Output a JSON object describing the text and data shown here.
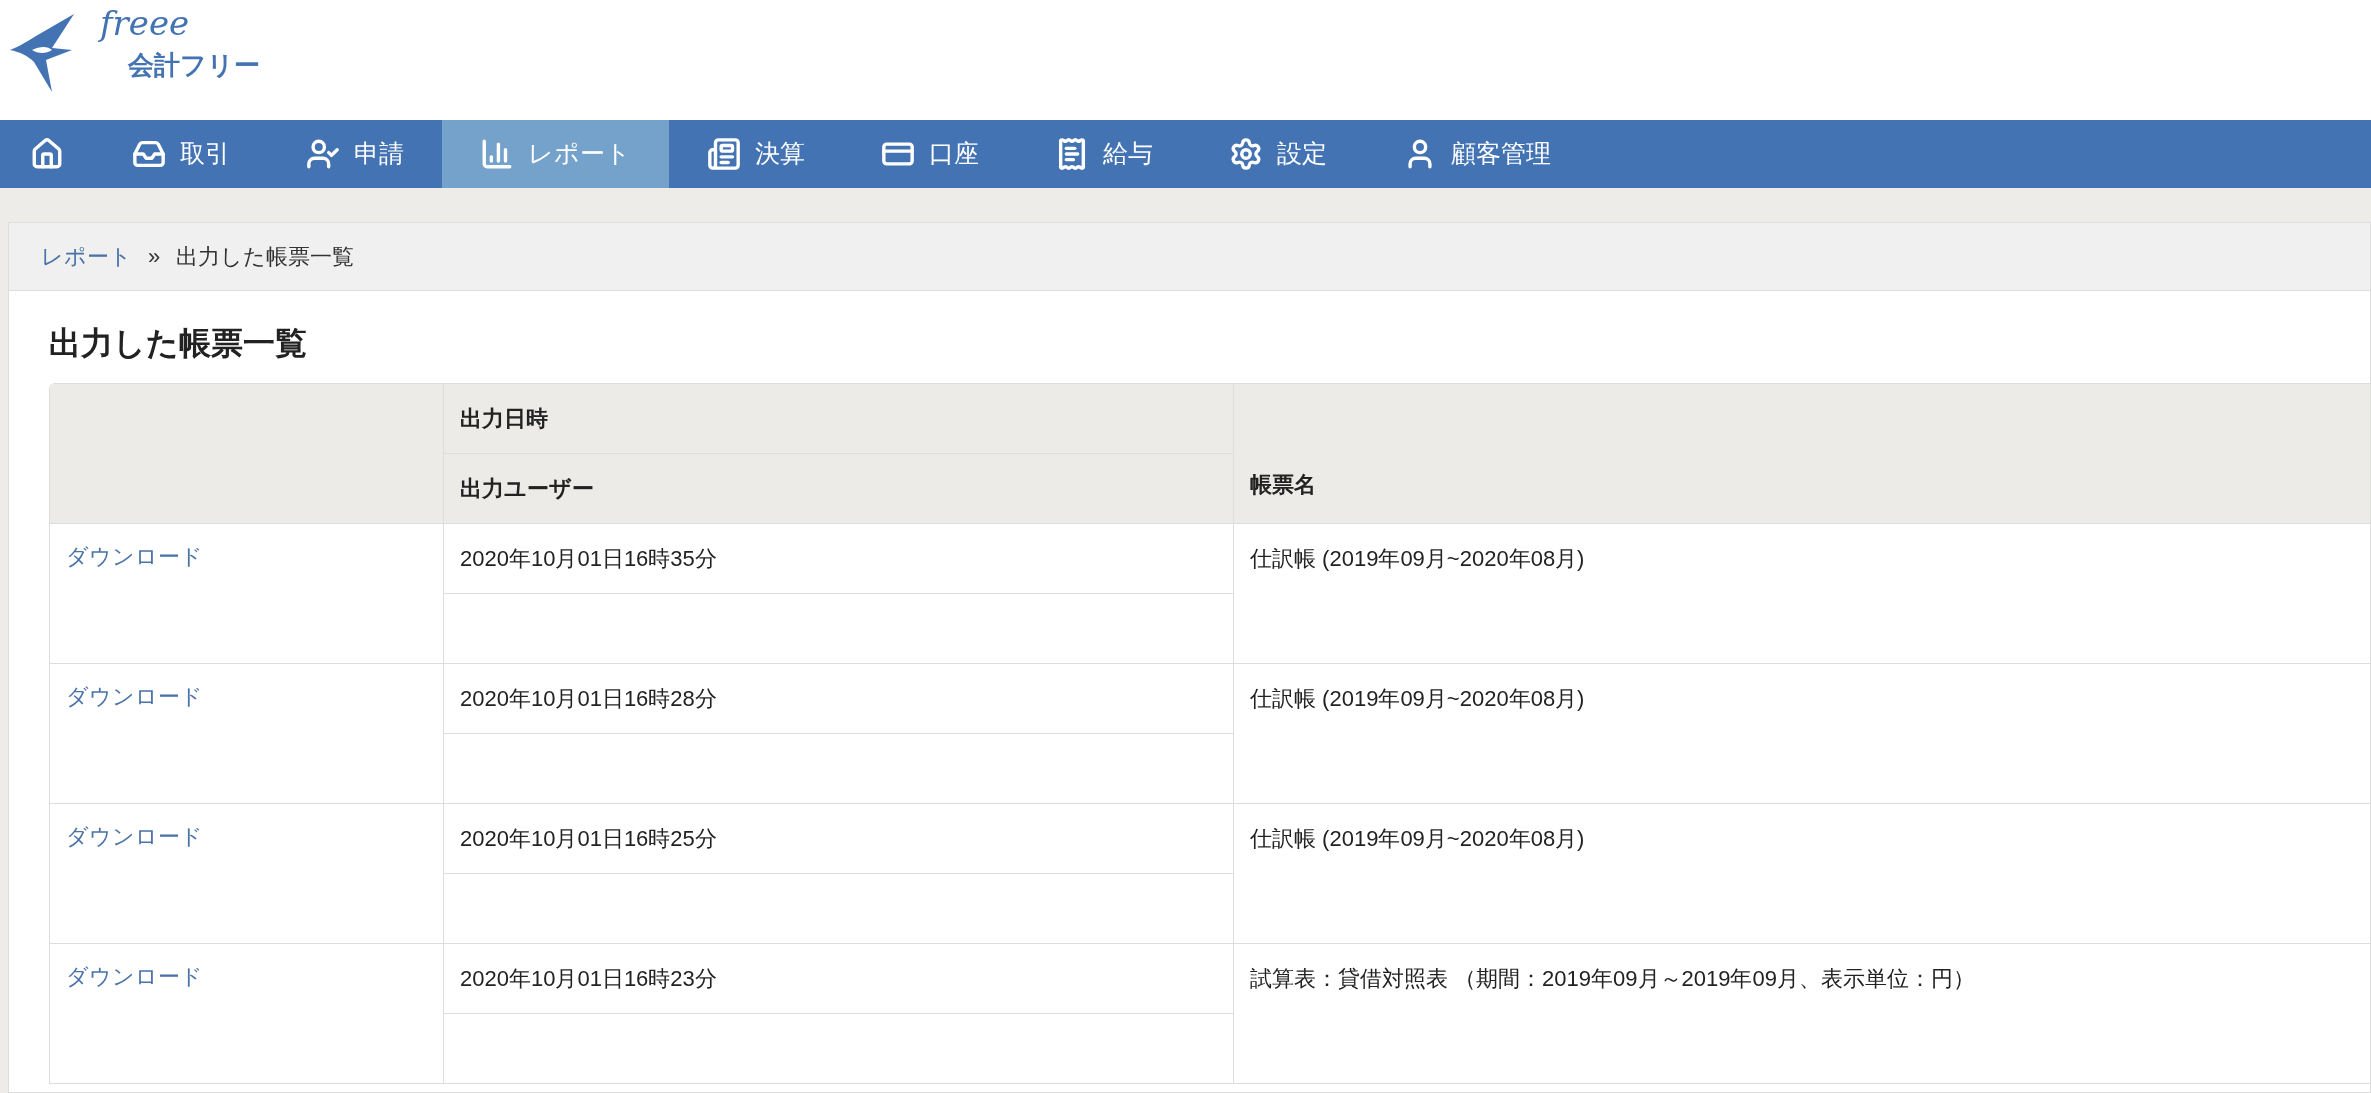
{
  "logo": {
    "script": "freee",
    "name": "会計フリー"
  },
  "nav": [
    {
      "kind": "home",
      "selected": false
    },
    {
      "kind": "link",
      "label": "取引",
      "selected": false
    },
    {
      "kind": "link",
      "label": "申請",
      "selected": false
    },
    {
      "kind": "link",
      "label": "レポート",
      "selected": true
    },
    {
      "kind": "link",
      "label": "決算",
      "selected": false
    },
    {
      "kind": "link",
      "label": "口座",
      "selected": false
    },
    {
      "kind": "link",
      "label": "給与",
      "selected": false
    },
    {
      "kind": "link",
      "label": "設定",
      "selected": false
    },
    {
      "kind": "link",
      "label": "顧客管理",
      "selected": false
    }
  ],
  "breadcrumb": {
    "parent": "レポート",
    "separator": "»",
    "current": "出力した帳票一覧"
  },
  "title": "出力した帳票一覧",
  "table": {
    "columns": {
      "datetime": "出力日時",
      "user": "出力ユーザー",
      "report": "帳票名"
    },
    "rows": [
      {
        "action": "ダウンロード",
        "datetime": "2020年10月01日16時35分",
        "report": "仕訳帳 (2019年09月~2020年08月)"
      },
      {
        "action": "ダウンロード",
        "datetime": "2020年10月01日16時28分",
        "report": "仕訳帳 (2019年09月~2020年08月)"
      },
      {
        "action": "ダウンロード",
        "datetime": "2020年10月01日16時25分",
        "report": "仕訳帳 (2019年09月~2020年08月)"
      },
      {
        "action": "ダウンロード",
        "datetime": "2020年10月01日16時23分",
        "report": "試算表：貸借対照表 （期間：2019年09月～2019年09月、表示単位：円）"
      }
    ]
  }
}
